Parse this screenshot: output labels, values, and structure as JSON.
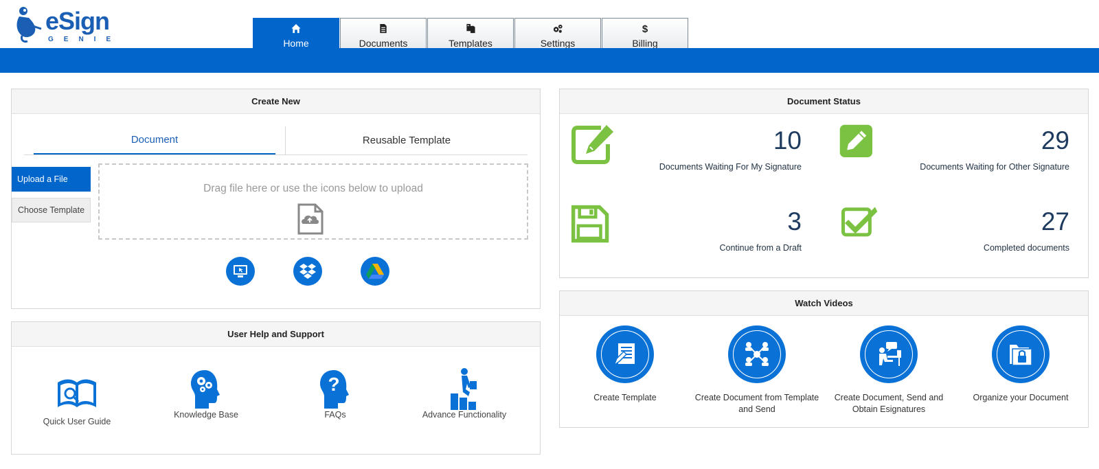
{
  "brand": {
    "name": "eSign",
    "sub": "GENIE"
  },
  "nav": [
    {
      "label": "Home",
      "icon": "home-icon",
      "active": true
    },
    {
      "label": "Documents",
      "icon": "document-icon"
    },
    {
      "label": "Templates",
      "icon": "templates-icon"
    },
    {
      "label": "Settings",
      "icon": "gears-icon"
    },
    {
      "label": "Billing",
      "icon": "dollar-icon"
    }
  ],
  "create_new": {
    "title": "Create New",
    "tabs": [
      "Document",
      "Reusable Template"
    ],
    "upload_button": "Upload a File",
    "choose_button": "Choose Template",
    "dropzone_text": "Drag file here or use the icons below to upload",
    "sources": [
      "computer-icon",
      "dropbox-icon",
      "google-drive-icon"
    ]
  },
  "help": {
    "title": "User Help and Support",
    "items": [
      "Quick User Guide",
      "Knowledge Base",
      "FAQs",
      "Advance Functionality"
    ]
  },
  "status": {
    "title": "Document Status",
    "items": [
      {
        "count": "10",
        "label": "Documents Waiting For My Signature",
        "icon": "edit-outline-icon"
      },
      {
        "count": "29",
        "label": "Documents Waiting for Other Signature",
        "icon": "edit-filled-icon"
      },
      {
        "count": "3",
        "label": "Continue from a Draft",
        "icon": "floppy-icon"
      },
      {
        "count": "27",
        "label": "Completed documents",
        "icon": "checkbox-icon"
      }
    ]
  },
  "videos": {
    "title": "Watch Videos",
    "items": [
      "Create Template",
      "Create Document from Template and Send",
      "Create Document, Send and Obtain Esignatures",
      "Organize your Document"
    ]
  },
  "colors": {
    "primary": "#0066cc",
    "accent": "#0a72d6",
    "green": "#7cc242"
  }
}
